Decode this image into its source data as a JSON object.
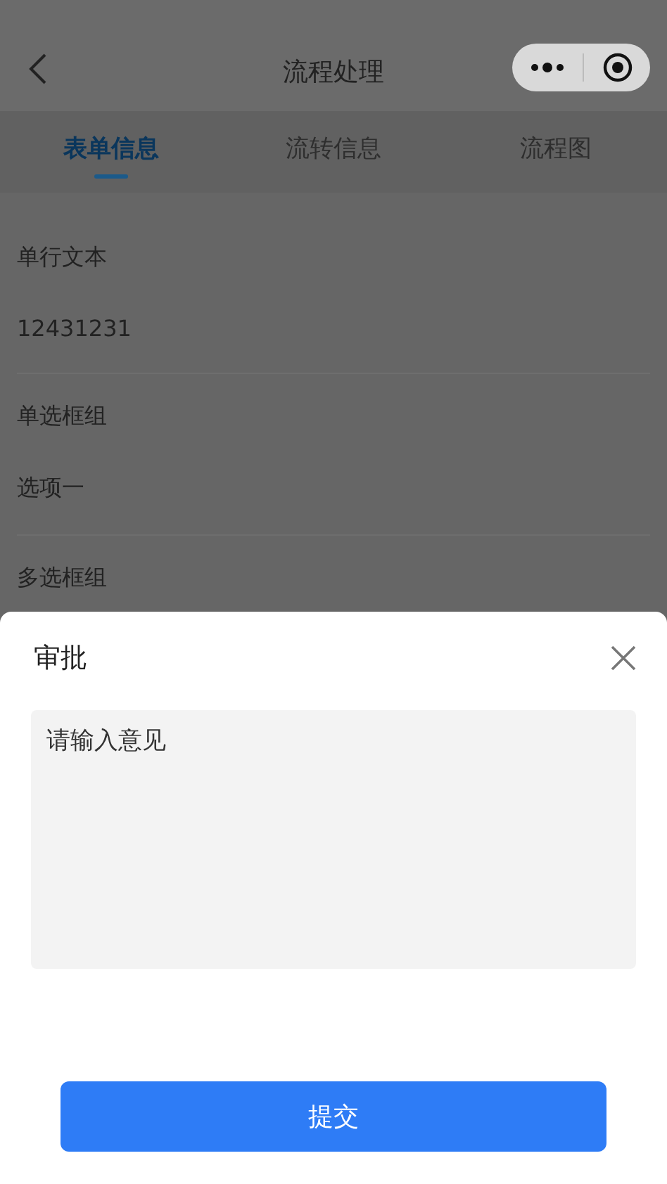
{
  "nav": {
    "title": "流程处理"
  },
  "tabs": [
    {
      "label": "表单信息",
      "selected": true
    },
    {
      "label": "流转信息",
      "selected": false
    },
    {
      "label": "流程图",
      "selected": false
    }
  ],
  "fields": [
    {
      "label": "单行文本",
      "value": "12431231"
    },
    {
      "label": "单选框组",
      "value": "选项一"
    },
    {
      "label": "多选框组"
    }
  ],
  "dialog": {
    "title": "审批",
    "comment": {
      "placeholder": "请输入意见"
    },
    "submit": "提交"
  }
}
